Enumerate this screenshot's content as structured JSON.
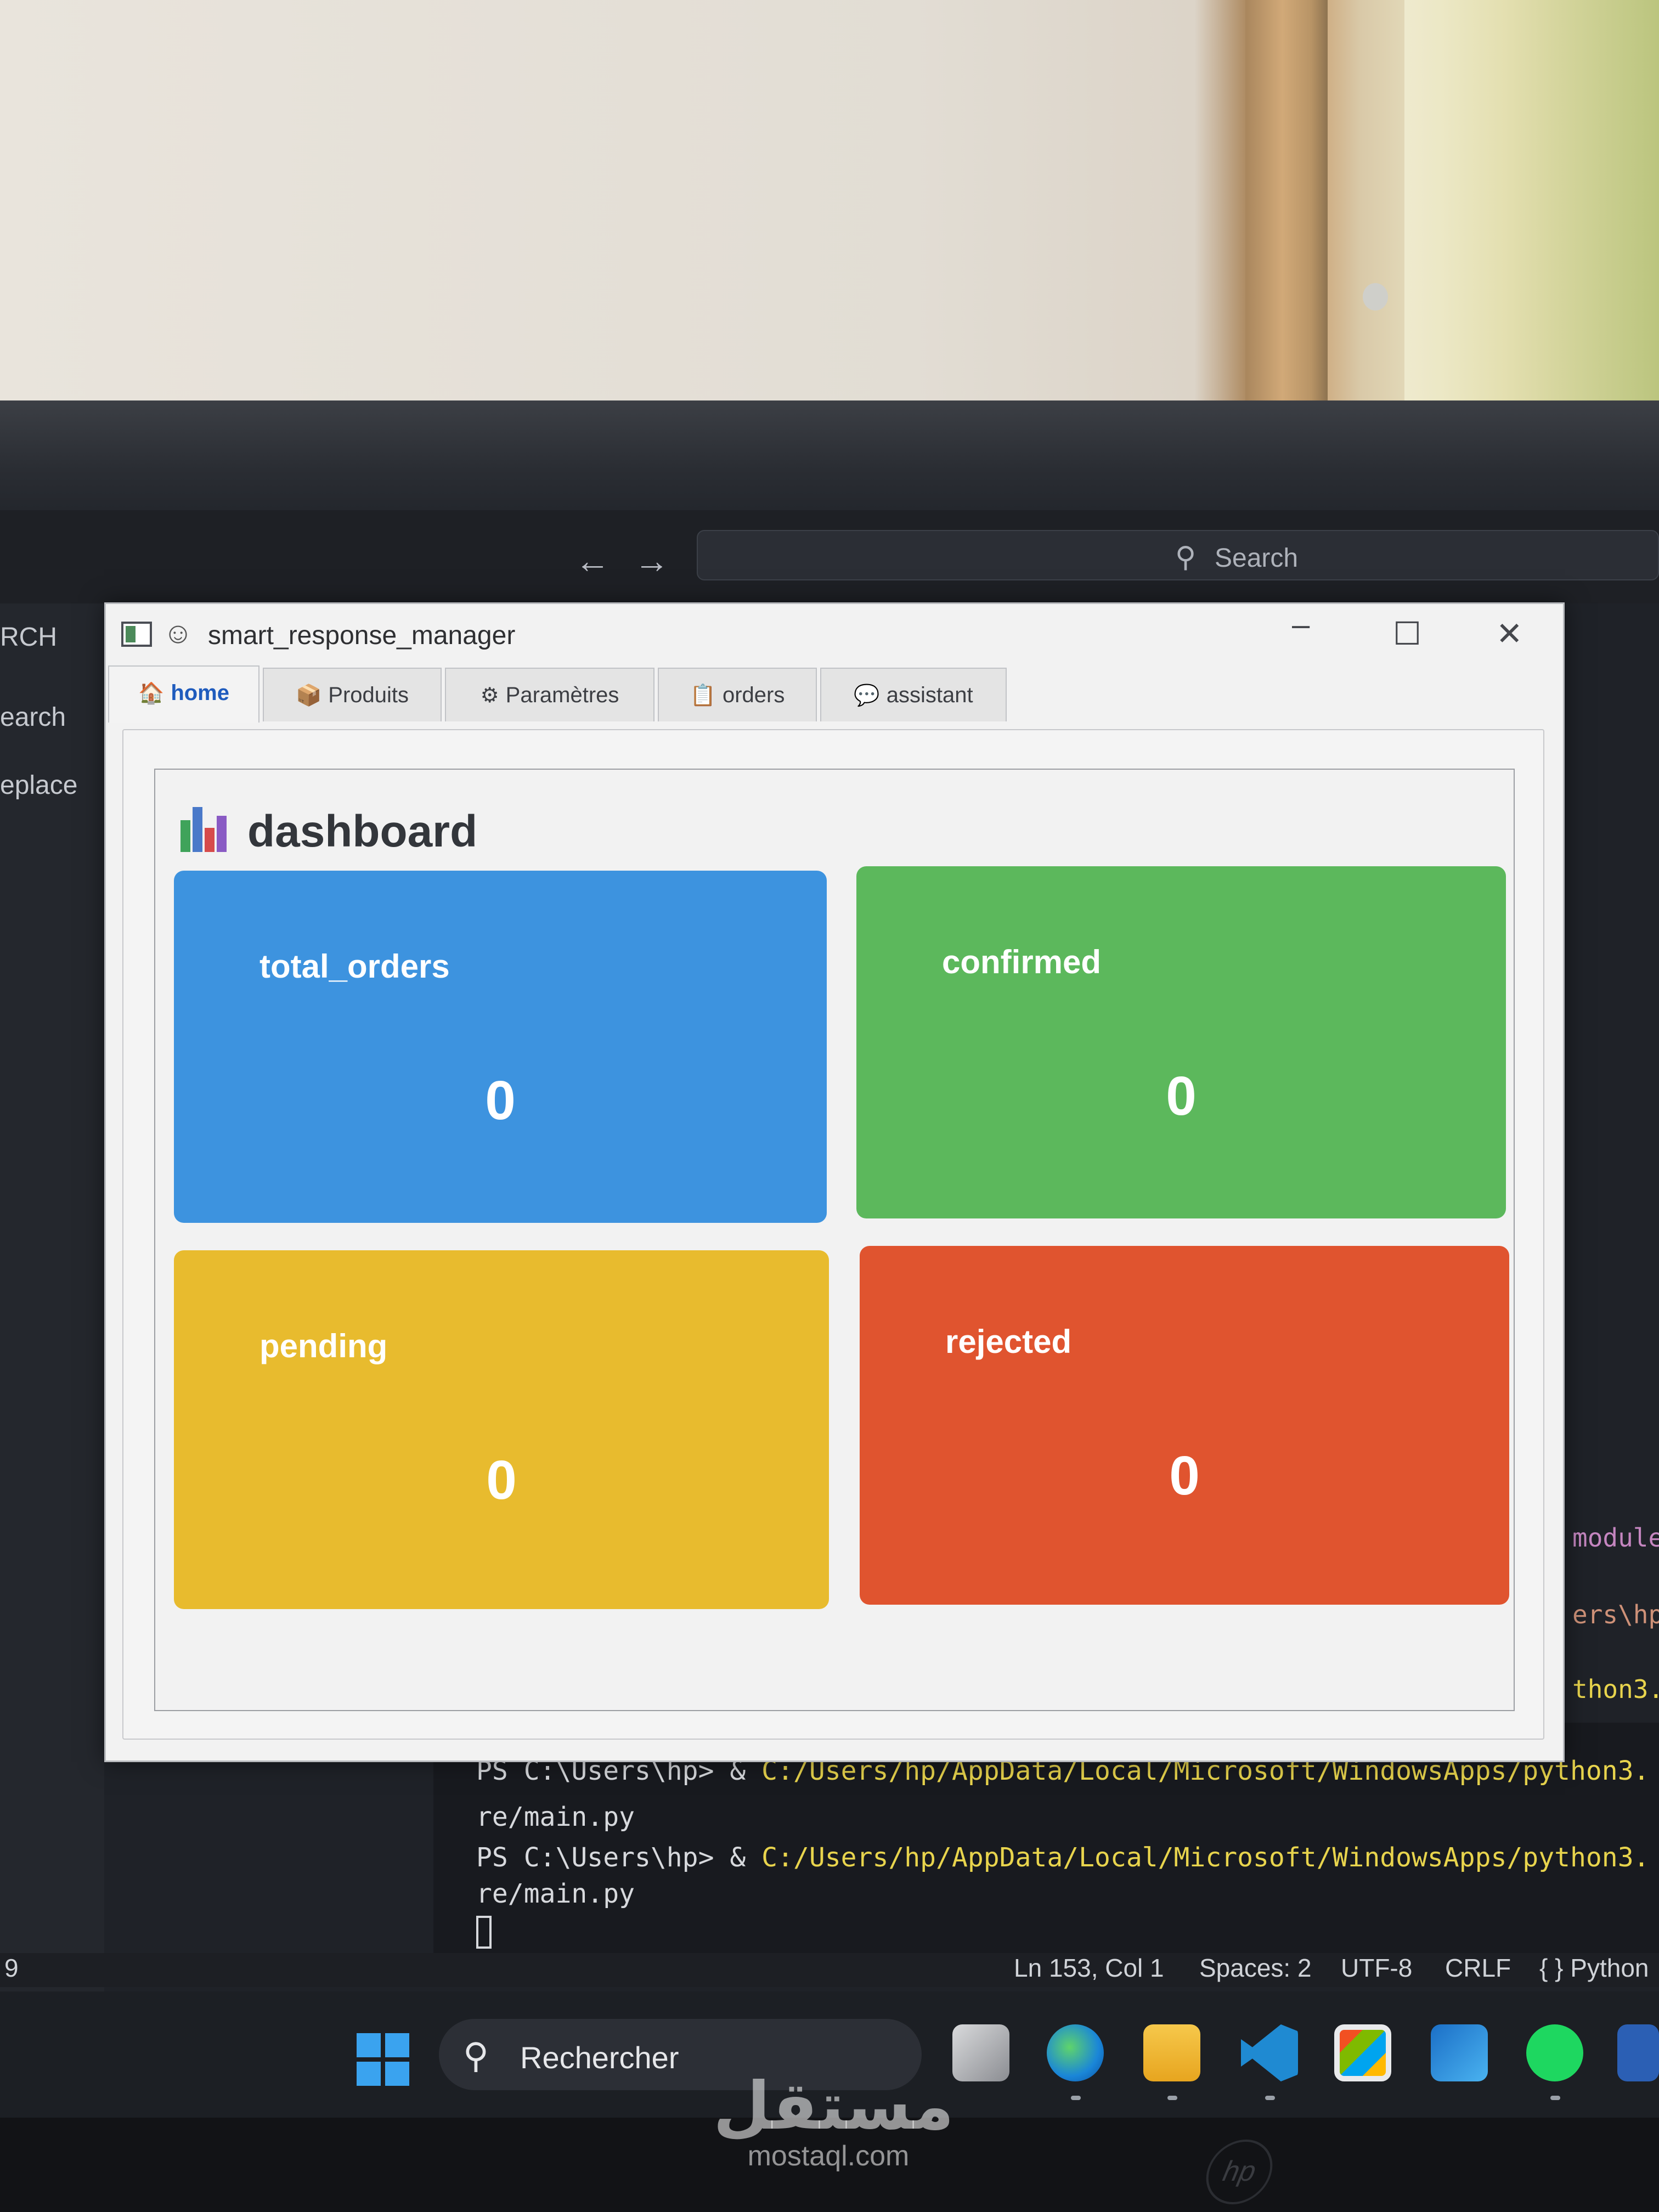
{
  "vscode": {
    "search_placeholder": "Search",
    "sidebar_items": [
      "RCH",
      "earch",
      "eplace"
    ],
    "terminal_lines": [
      {
        "prompt": "PS C:\\Users\\hp> & ",
        "path": "C:/Users/hp/AppData/Local/Microsoft/WindowsApps/python3."
      },
      {
        "prompt": "re/main.py",
        "path": ""
      },
      {
        "prompt": "PS C:\\Users\\hp> & ",
        "path": "C:/Users/hp/AppData/Local/Microsoft/WindowsApps/python3."
      },
      {
        "prompt": "re/main.py",
        "path": ""
      }
    ],
    "right_fragments": [
      "module",
      "ers\\hp",
      "thon3."
    ],
    "status": {
      "left_num": "9",
      "position": "Ln 153, Col 1",
      "spaces": "Spaces: 2",
      "encoding": "UTF-8",
      "eol": "CRLF",
      "language": "{ } Python"
    }
  },
  "app": {
    "title": "smart_response_manager",
    "tabs": [
      {
        "icon": "🏠",
        "label": "home",
        "active": true
      },
      {
        "icon": "📦",
        "label": "Produits",
        "active": false
      },
      {
        "icon": "⚙",
        "label": "Paramètres",
        "active": false
      },
      {
        "icon": "📋",
        "label": "orders",
        "active": false
      },
      {
        "icon": "💬",
        "label": "assistant",
        "active": false
      }
    ],
    "dashboard": {
      "title": "dashboard",
      "cards": [
        {
          "label": "total_orders",
          "value": "0",
          "color": "#3d93df"
        },
        {
          "label": "confirmed",
          "value": "0",
          "color": "#5cb85c"
        },
        {
          "label": "pending",
          "value": "0",
          "color": "#e8bb2e"
        },
        {
          "label": "rejected",
          "value": "0",
          "color": "#e0542f"
        }
      ]
    }
  },
  "taskbar": {
    "search_text": "Rechercher"
  },
  "watermark": {
    "arabic": "مستقل",
    "latin": "mostaql.com"
  }
}
